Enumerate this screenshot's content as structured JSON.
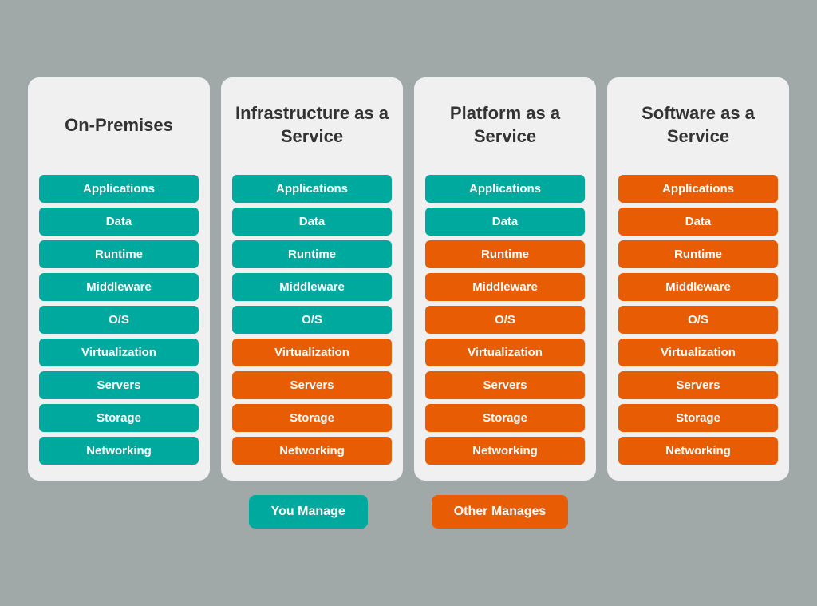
{
  "columns": [
    {
      "id": "on-premises",
      "title": "On-Premises",
      "items": [
        {
          "label": "Applications",
          "color": "teal"
        },
        {
          "label": "Data",
          "color": "teal"
        },
        {
          "label": "Runtime",
          "color": "teal"
        },
        {
          "label": "Middleware",
          "color": "teal"
        },
        {
          "label": "O/S",
          "color": "teal"
        },
        {
          "label": "Virtualization",
          "color": "teal"
        },
        {
          "label": "Servers",
          "color": "teal"
        },
        {
          "label": "Storage",
          "color": "teal"
        },
        {
          "label": "Networking",
          "color": "teal"
        }
      ]
    },
    {
      "id": "iaas",
      "title": "Infrastructure as a Service",
      "items": [
        {
          "label": "Applications",
          "color": "teal"
        },
        {
          "label": "Data",
          "color": "teal"
        },
        {
          "label": "Runtime",
          "color": "teal"
        },
        {
          "label": "Middleware",
          "color": "teal"
        },
        {
          "label": "O/S",
          "color": "teal"
        },
        {
          "label": "Virtualization",
          "color": "orange"
        },
        {
          "label": "Servers",
          "color": "orange"
        },
        {
          "label": "Storage",
          "color": "orange"
        },
        {
          "label": "Networking",
          "color": "orange"
        }
      ]
    },
    {
      "id": "paas",
      "title": "Platform as a Service",
      "items": [
        {
          "label": "Applications",
          "color": "teal"
        },
        {
          "label": "Data",
          "color": "teal"
        },
        {
          "label": "Runtime",
          "color": "orange"
        },
        {
          "label": "Middleware",
          "color": "orange"
        },
        {
          "label": "O/S",
          "color": "orange"
        },
        {
          "label": "Virtualization",
          "color": "orange"
        },
        {
          "label": "Servers",
          "color": "orange"
        },
        {
          "label": "Storage",
          "color": "orange"
        },
        {
          "label": "Networking",
          "color": "orange"
        }
      ]
    },
    {
      "id": "saas",
      "title": "Software as a Service",
      "items": [
        {
          "label": "Applications",
          "color": "orange"
        },
        {
          "label": "Data",
          "color": "orange"
        },
        {
          "label": "Runtime",
          "color": "orange"
        },
        {
          "label": "Middleware",
          "color": "orange"
        },
        {
          "label": "O/S",
          "color": "orange"
        },
        {
          "label": "Virtualization",
          "color": "orange"
        },
        {
          "label": "Servers",
          "color": "orange"
        },
        {
          "label": "Storage",
          "color": "orange"
        },
        {
          "label": "Networking",
          "color": "orange"
        }
      ]
    }
  ],
  "legend": {
    "you_manage": "You Manage",
    "other_manages": "Other Manages"
  }
}
